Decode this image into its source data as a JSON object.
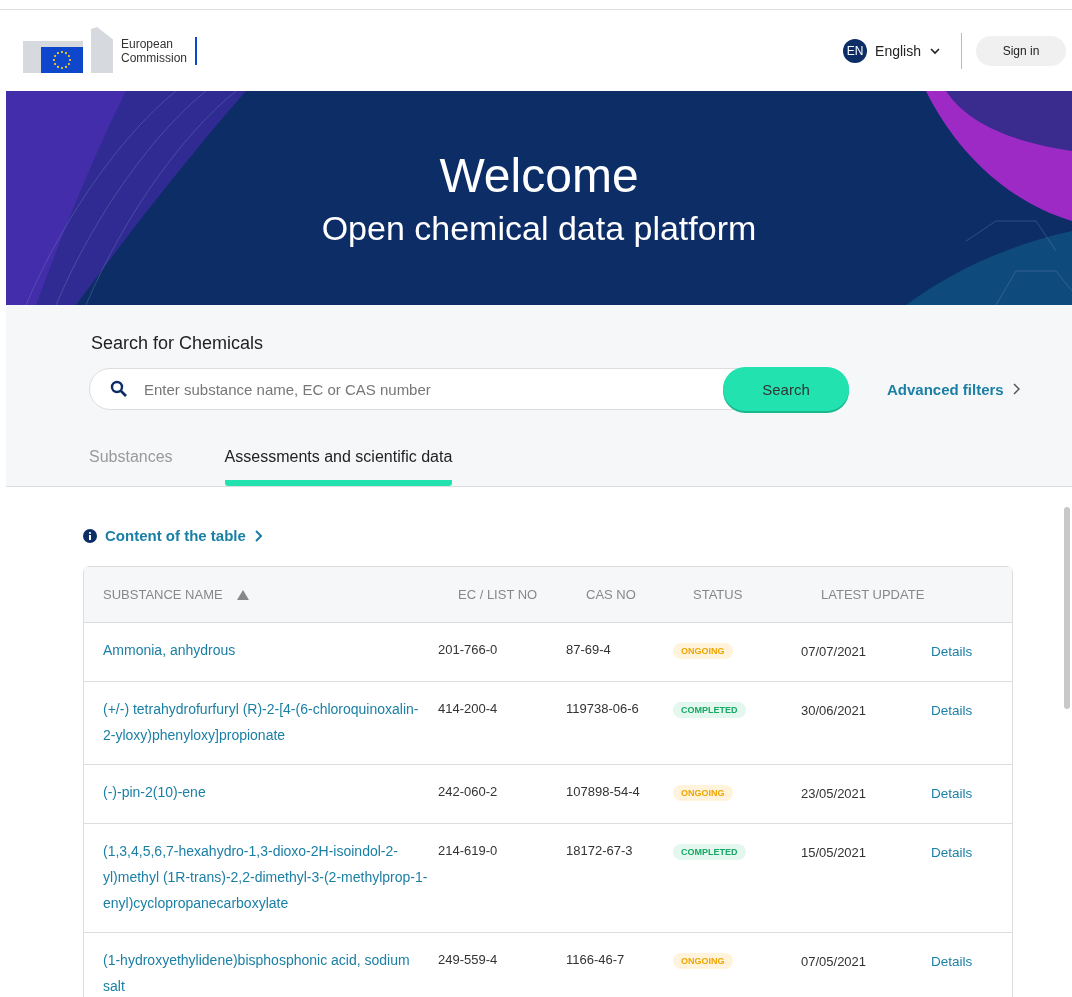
{
  "header": {
    "logo_text": [
      "European",
      "Commission"
    ],
    "language_code": "EN",
    "language": "English",
    "sign_in": "Sign in"
  },
  "banner": {
    "title": "Welcome",
    "subtitle": "Open chemical data platform"
  },
  "search": {
    "heading": "Search for Chemicals",
    "placeholder": "Enter substance name, EC or CAS number",
    "button": "Search",
    "advanced": "Advanced filters"
  },
  "tabs": [
    {
      "label": "Substances",
      "selected": false
    },
    {
      "label": "Assessments and scientific data",
      "selected": true
    }
  ],
  "info_link": "Content of the table",
  "table": {
    "columns": [
      {
        "label": "SUBSTANCE NAME",
        "sorted": true
      },
      {
        "label": "EC / LIST NO",
        "sorted": false
      },
      {
        "label": "CAS NO",
        "sorted": false
      },
      {
        "label": "STATUS",
        "sorted": false
      },
      {
        "label": "LATEST UPDATE",
        "sorted": false
      }
    ],
    "rows": [
      {
        "name": "Ammonia, anhydrous",
        "ec": "201-766-0",
        "cas": "87-69-4",
        "status": "ONGOING",
        "kind": "ongoing",
        "updated": "07/07/2021",
        "link": "Details"
      },
      {
        "name": "(+/-) tetrahydrofurfuryl (R)-2-[4-(6-chloroquinoxalin-2-yloxy)phenyloxy]propionate",
        "ec": "414-200-4",
        "cas": "119738-06-6",
        "status": "COMPLETED",
        "kind": "completed",
        "updated": "30/06/2021",
        "link": "Details"
      },
      {
        "name": "(-)-pin-2(10)-ene",
        "ec": "242-060-2",
        "cas": "107898-54-4",
        "status": "ONGOING",
        "kind": "ongoing",
        "updated": "23/05/2021",
        "link": "Details"
      },
      {
        "name": "(1,3,4,5,6,7-hexahydro-1,3-dioxo-2H-isoindol-2-yl)methyl (1R-trans)-2,2-dimethyl-3-(2-methylprop-1-enyl)cyclopropanecarboxylate",
        "ec": "214-619-0",
        "cas": "18172-67-3",
        "status": "COMPLETED",
        "kind": "completed",
        "updated": "15/05/2021",
        "link": "Details"
      },
      {
        "name": "(1-hydroxyethylidene)bisphosphonic acid, sodium salt",
        "ec": "249-559-4",
        "cas": "1166-46-7",
        "status": "ONGOING",
        "kind": "ongoing",
        "updated": "07/05/2021",
        "link": "Details"
      }
    ]
  }
}
